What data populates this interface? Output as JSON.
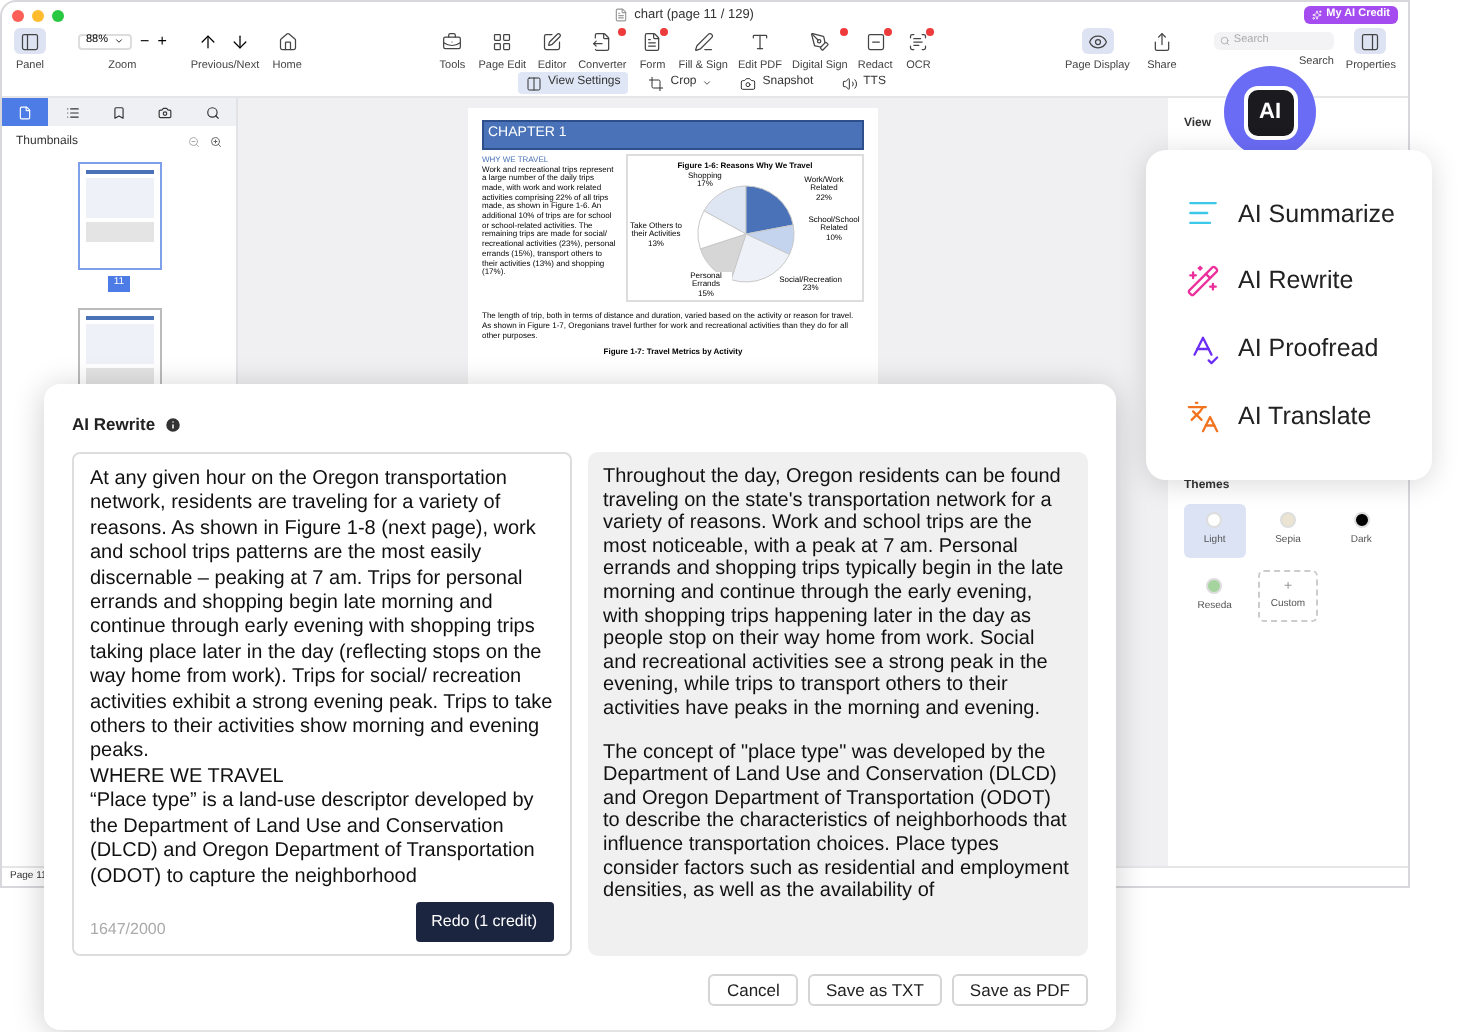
{
  "window": {
    "title": "chart (page 11 / 129)",
    "ai_credit": "My AI Credit",
    "logo_text": "AI"
  },
  "toolbar": {
    "panel": {
      "label": "Panel",
      "selected": true
    },
    "zoom": {
      "value": "88%",
      "label": "Zoom",
      "minus": "−",
      "plus": "+"
    },
    "nav": [
      {
        "label": "Previous/Next"
      },
      {
        "label": "Home"
      }
    ],
    "tools": [
      {
        "label": "Tools",
        "badge": false
      },
      {
        "label": "Page Edit",
        "badge": false
      },
      {
        "label": "Editor",
        "badge": false
      },
      {
        "label": "Converter",
        "badge": true
      },
      {
        "label": "Form",
        "badge": true
      },
      {
        "label": "Fill & Sign",
        "badge": false
      },
      {
        "label": "Edit PDF",
        "badge": false
      },
      {
        "label": "Digital Sign",
        "badge": true
      },
      {
        "label": "Redact",
        "badge": true
      },
      {
        "label": "OCR",
        "badge": true
      }
    ],
    "right_tools": [
      {
        "label": "Page Display",
        "selected": true
      },
      {
        "label": "Share",
        "selected": false
      }
    ],
    "search": {
      "placeholder": "Search",
      "label": "Search"
    },
    "properties": {
      "label": "Properties",
      "selected": true
    },
    "view_bar": [
      {
        "label": "View Settings",
        "selected": true,
        "dropdown": false
      },
      {
        "label": "Crop",
        "selected": false,
        "dropdown": true
      },
      {
        "label": "Snapshot",
        "selected": false,
        "dropdown": false
      },
      {
        "label": "TTS",
        "selected": false,
        "dropdown": false
      }
    ]
  },
  "sidebar": {
    "tabs": [
      {
        "selected": true
      },
      {
        "selected": false
      },
      {
        "selected": false
      },
      {
        "selected": false
      },
      {
        "selected": false
      }
    ],
    "title": "Thumbnails",
    "thumbnails": [
      {
        "page": "11",
        "selected": true
      },
      {
        "selected": false
      }
    ]
  },
  "document": {
    "chapter": "CHAPTER 1",
    "heading": "WHY WE TRAVEL",
    "paragraph": "Work and recreational trips represent a large number of the daily trips made, with work and work related activities comprising 22% of all trips made, as shown in Figure 1-6. An additional 10% of trips are for school or school-related activities. The remaining trips are made for social/ recreational activities (23%), personal errands (15%), transport others to their activities (13%) and shopping (17%).",
    "chart_data": {
      "type": "pie",
      "title": "Figure 1-6: Reasons Why We Travel",
      "categories": [
        "Shopping",
        "Work/Work Related",
        "School/School Related",
        "Social/Recreation",
        "Personal Errands",
        "Take Others to their Activities"
      ],
      "values": [
        17,
        22,
        10,
        23,
        15,
        13
      ],
      "value_labels": [
        "17%",
        "22%",
        "10%",
        "23%",
        "15%",
        "13%"
      ]
    },
    "paragraph_2": "The length of trip, both in terms of distance and duration, varied based on the activity or reason for travel. As shown in Figure 1-7, Oregonians travel further for work and recreational activities than they do for all other purposes.",
    "figure_caption": "Figure 1-7: Travel Metrics by Activity"
  },
  "properties_panel": {
    "heading": "View",
    "themes_title": "Themes",
    "themes": [
      {
        "label": "Light",
        "selected": true,
        "color": "#ffffff"
      },
      {
        "label": "Sepia",
        "selected": false,
        "color": "#ece3d3"
      },
      {
        "label": "Dark",
        "selected": false,
        "color": "#000000"
      },
      {
        "label": "Reseda",
        "selected": false,
        "color": "#a6d49f"
      }
    ],
    "custom": {
      "label": "Custom",
      "icon": "+"
    }
  },
  "ai_menu": [
    {
      "label": "AI Summarize",
      "color": "#3cc8e8"
    },
    {
      "label": "AI Rewrite",
      "color": "#ec2f9b"
    },
    {
      "label": "AI Proofread",
      "color": "#6b2cf5"
    },
    {
      "label": "AI Translate",
      "color": "#f2731f"
    }
  ],
  "dialog": {
    "title": "AI Rewrite",
    "input_lines": [
      "At any given hour on the Oregon transportation network, residents are traveling for a variety of reasons. As shown in Figure 1-8 (next page), work and school trips patterns are the most easily discernable – peaking at 7 am. Trips for personal errands and shopping begin late morning and continue through early evening with shopping trips taking place later in the day (reflecting stops on the way home from work). Trips for social/ recreation activities exhibit a strong evening peak. Trips to take others to their activities show morning and evening peaks.",
      "WHERE WE TRAVEL",
      "“Place type” is a land-use descriptor developed by the Department of Land Use and Conservation (DLCD) and Oregon Department of Transportation (ODOT) to capture the neighborhood"
    ],
    "counter": "1647/2000",
    "redo": "Redo (1 credit)",
    "output_paragraphs": [
      "Throughout the day, Oregon residents can be found traveling on the state's transportation network for a variety of reasons. Work and school trips are the most noticeable, with a peak at 7 am. Personal errands and shopping trips typically begin in the late morning and continue through the early evening, with shopping trips happening later in the day as people stop on their way home from work. Social and recreational activities see a strong peak in the evening, while trips to transport others to their activities have peaks in the morning and evening.",
      "The concept of \"place type\" was developed by the Department of Land Use and Conservation (DLCD) and Oregon Department of Transportation (ODOT) to describe the characteristics of neighborhoods that influence transportation choices. Place types consider factors such as residential and employment densities, as well as the availability of"
    ],
    "buttons": [
      "Cancel",
      "Save as TXT",
      "Save as PDF"
    ]
  },
  "status_bar": {
    "page": "Page 11"
  }
}
